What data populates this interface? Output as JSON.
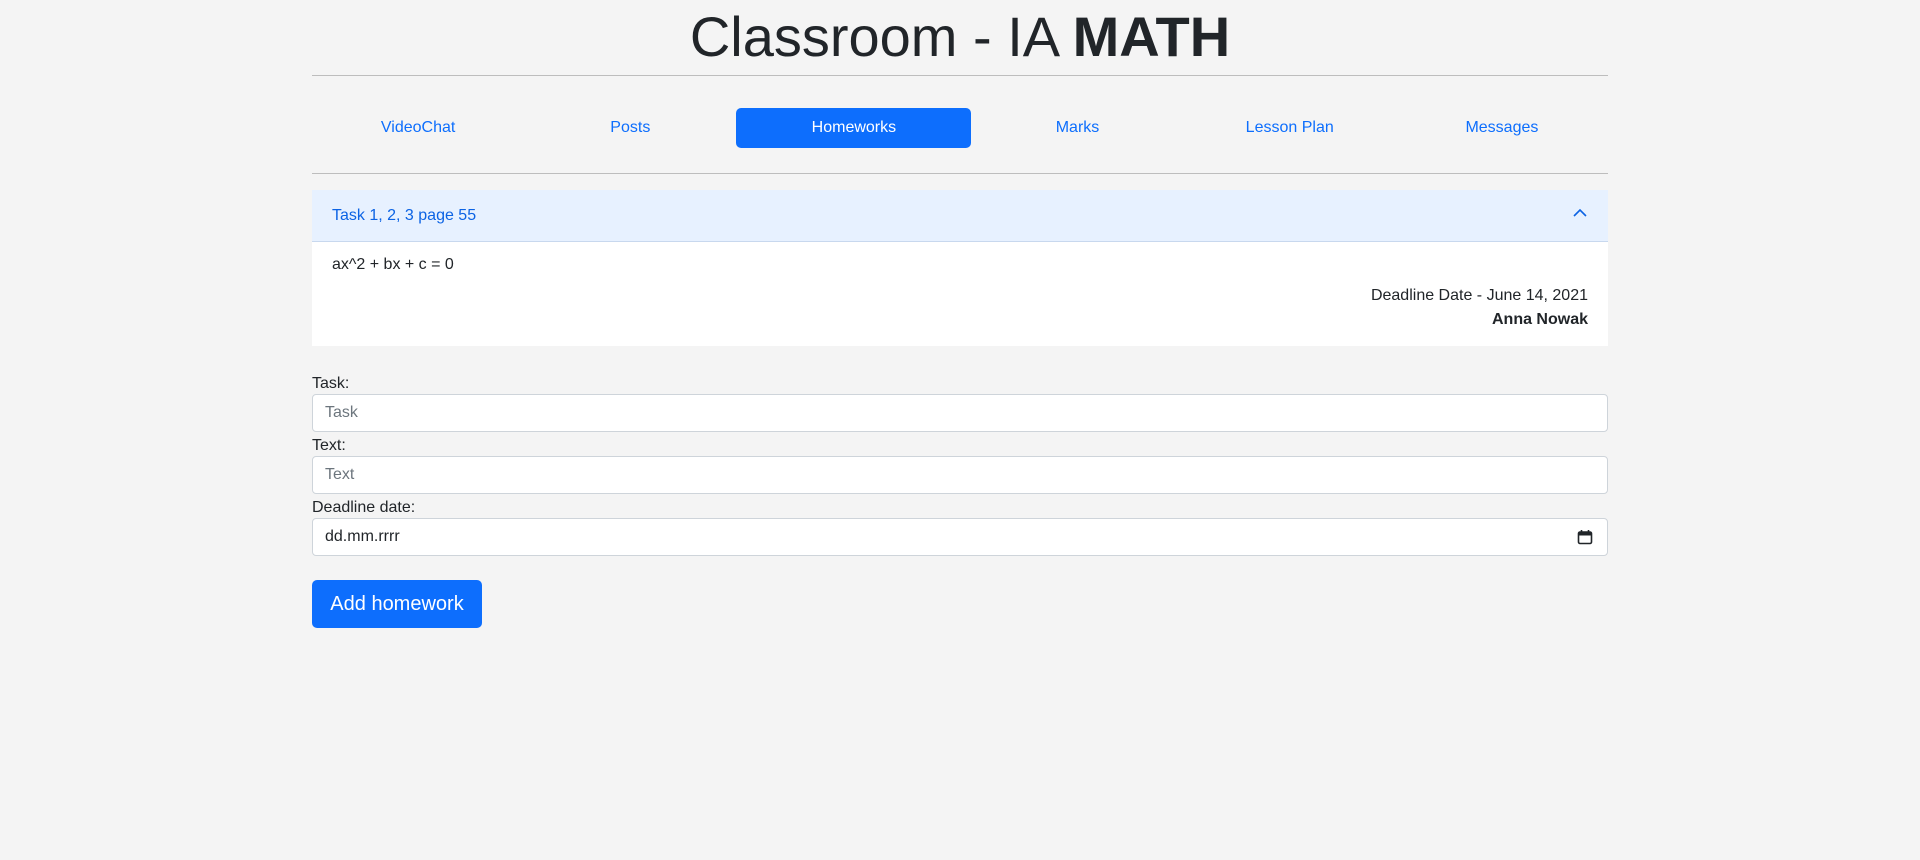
{
  "header": {
    "title_light": "Classroom - IA ",
    "title_bold": "MATH"
  },
  "nav": {
    "items": [
      {
        "label": "VideoChat"
      },
      {
        "label": "Posts"
      },
      {
        "label": "Homeworks",
        "active": true
      },
      {
        "label": "Marks"
      },
      {
        "label": "Lesson Plan"
      },
      {
        "label": "Messages"
      }
    ]
  },
  "homework": {
    "task": "Task 1, 2, 3 page 55",
    "text": "ax^2 + bx + c = 0",
    "deadline": "Deadline Date - June 14, 2021",
    "author": "Anna Nowak"
  },
  "form": {
    "task_label": "Task:",
    "task_placeholder": "Task",
    "text_label": "Text:",
    "text_placeholder": "Text",
    "deadline_label": "Deadline date:",
    "deadline_placeholder": "dd.mm.rrrr",
    "submit_label": "Add homework"
  },
  "colors": {
    "accent": "#0d6efd",
    "accordion_bg": "#e7f1ff",
    "page_bg": "#f4f4f4"
  },
  "icons": {
    "collapse": "chevron-up-icon",
    "calendar": "calendar-icon"
  }
}
